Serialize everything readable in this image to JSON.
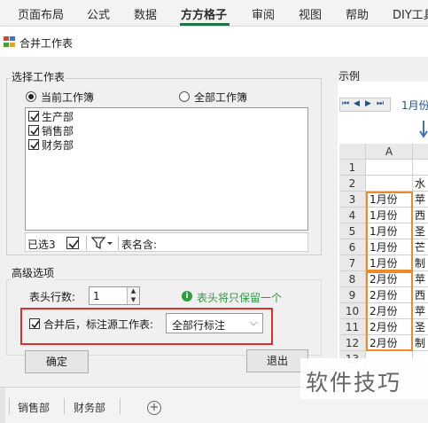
{
  "ribbon": {
    "tabs": [
      "页面布局",
      "公式",
      "数据",
      "方方格子",
      "审阅",
      "视图",
      "帮助",
      "DIY工具"
    ],
    "active": "方方格子",
    "accent_color": "#217346"
  },
  "dialog": {
    "title": "合并工作表",
    "select_group": {
      "label": "选择工作表",
      "radio_current": "当前工作簿",
      "radio_all": "全部工作簿",
      "selected": "当前工作簿",
      "sheets": [
        {
          "name": "生产部",
          "checked": true
        },
        {
          "name": "销售部",
          "checked": true
        },
        {
          "name": "财务部",
          "checked": true
        }
      ],
      "selected_count_label": "已选3",
      "filter_icon": "filter-icon",
      "sheet_name_label": "表名含:",
      "sheet_name_value": ""
    },
    "advanced": {
      "label": "高级选项",
      "header_rows_label": "表头行数:",
      "header_rows_value": "1",
      "info_text": "表头将只保留一个",
      "merge_check_label": "合并后，标注源工作表:",
      "merge_checked": true,
      "mark_mode": "全部行标注",
      "highlight_color": "#d9322b"
    },
    "buttons": {
      "ok": "确定",
      "exit": "退出"
    },
    "example": {
      "label": "示例",
      "sheet_tab": "1月份",
      "col_header": "A",
      "row_numbers": [
        "1",
        "2",
        "3",
        "4",
        "5",
        "6",
        "7",
        "8",
        "9",
        "10",
        "11",
        "12",
        "13"
      ],
      "col_a": [
        "",
        "",
        "1月份",
        "1月份",
        "1月份",
        "1月份",
        "1月份",
        "2月份",
        "2月份",
        "2月份",
        "2月份",
        "2月份",
        ""
      ],
      "col_b": [
        "",
        "水",
        "苹",
        "西",
        "圣",
        "芒",
        "制",
        "苹",
        "西",
        "苹",
        "圣",
        "制",
        ""
      ],
      "highlight_color": "#ee8a2a"
    }
  },
  "sheet_tabs": [
    "销售部",
    "财务部"
  ],
  "watermark": "软件技巧"
}
